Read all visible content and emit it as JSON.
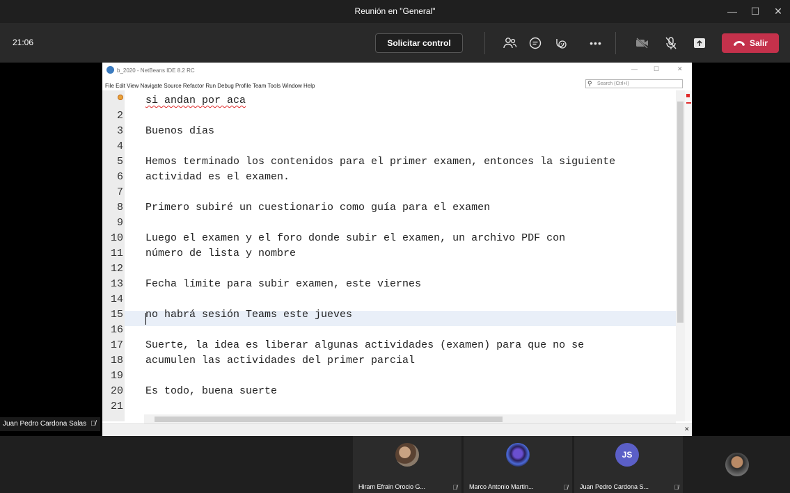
{
  "window": {
    "title": "Reunión en \"General\""
  },
  "header": {
    "time": "21:06",
    "request_control_label": "Solicitar control",
    "leave_label": "Salir"
  },
  "shared_app": {
    "title": "b_2020 - NetBeans IDE 8.2 RC",
    "menu": "File  Edit  View  Navigate  Source  Refactor  Run  Debug  Profile  Team  Tools  Window  Help",
    "search_placeholder": "Search (Ctrl+I)",
    "lines": [
      {
        "num": "",
        "text": "si andan por aca"
      },
      {
        "num": "2",
        "text": ""
      },
      {
        "num": "3",
        "text": "Buenos días"
      },
      {
        "num": "4",
        "text": ""
      },
      {
        "num": "5",
        "text": "Hemos terminado los contenidos para el primer examen, entonces la siguiente"
      },
      {
        "num": "6",
        "text": "actividad es el examen."
      },
      {
        "num": "7",
        "text": ""
      },
      {
        "num": "8",
        "text": "Primero subiré un cuestionario como guía para el examen"
      },
      {
        "num": "9",
        "text": ""
      },
      {
        "num": "10",
        "text": "Luego el examen y el foro donde subir el examen, un archivo PDF con"
      },
      {
        "num": "11",
        "text": "número de lista y nombre"
      },
      {
        "num": "12",
        "text": ""
      },
      {
        "num": "13",
        "text": "Fecha límite para subir examen, este viernes"
      },
      {
        "num": "14",
        "text": ""
      },
      {
        "num": "15",
        "text": "no habrá sesión Teams este jueves"
      },
      {
        "num": "16",
        "text": ""
      },
      {
        "num": "17",
        "text": "Suerte, la idea es liberar algunas actividades (examen) para que no se"
      },
      {
        "num": "18",
        "text": "acumulen las actividades del primer parcial"
      },
      {
        "num": "19",
        "text": ""
      },
      {
        "num": "20",
        "text": "Es todo, buena suerte"
      },
      {
        "num": "21",
        "text": ""
      }
    ]
  },
  "presenter": {
    "name": "Juan Pedro Cardona Salas"
  },
  "participants": [
    {
      "name": "Hiram Efrain Orocio G...",
      "avatar": "photo"
    },
    {
      "name": "Marco Antonio Martin...",
      "avatar": "photo"
    },
    {
      "name": "Juan Pedro Cardona S...",
      "initials": "JS"
    }
  ],
  "colors": {
    "leave_button": "#c4314b",
    "initials_avatar": "#5b5fc7"
  }
}
